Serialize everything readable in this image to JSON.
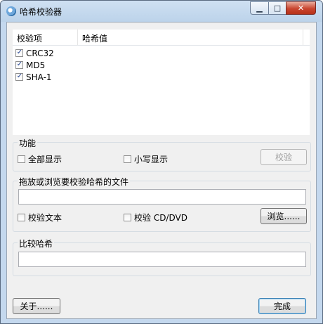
{
  "window": {
    "title": "哈希校验器"
  },
  "list": {
    "headers": [
      "校验项",
      "哈希值"
    ],
    "items": [
      {
        "label": "CRC32",
        "checked": true
      },
      {
        "label": "MD5",
        "checked": true
      },
      {
        "label": "SHA-1",
        "checked": true
      }
    ]
  },
  "functions": {
    "label": "功能",
    "show_all": "全部显示",
    "lowercase": "小写显示",
    "verify_button": "校验"
  },
  "file_group": {
    "label": "拖放或浏览要校验哈希的文件",
    "path_value": "",
    "verify_text": "校验文本",
    "verify_cd": "校验 CD/DVD",
    "browse_button": "浏览......"
  },
  "compare": {
    "label": "比较哈希",
    "value": ""
  },
  "footer": {
    "about_button": "关于......",
    "done_button": "完成"
  }
}
